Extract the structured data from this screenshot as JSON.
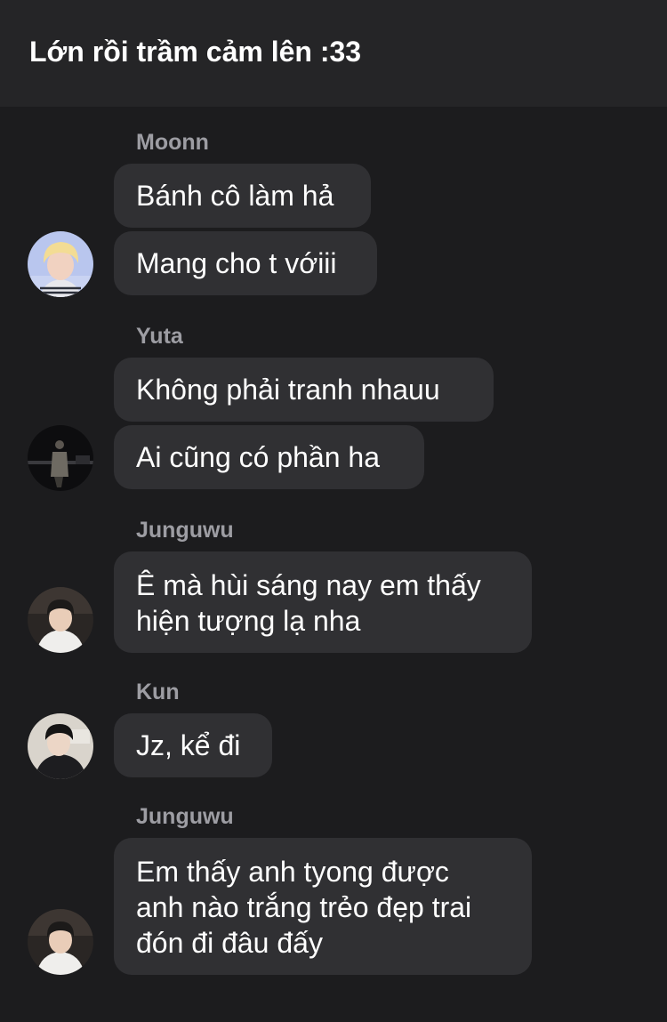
{
  "header": {
    "title": "Lớn rồi trầm cảm lên :33"
  },
  "groups": [
    {
      "sender": "Moonn",
      "avatar_icon": "blonde-person-avatar",
      "messages": [
        "Bánh cô làm hả",
        "Mang cho t vớiii"
      ]
    },
    {
      "sender": "Yuta",
      "avatar_icon": "dark-scene-person-avatar",
      "messages": [
        "Không phải tranh nhauu",
        "Ai cũng có phần ha"
      ]
    },
    {
      "sender": "Junguwu",
      "avatar_icon": "person-white-shirt-avatar",
      "messages": [
        [
          "Ê mà hùi sáng nay em thấy",
          "hiện tượng lạ nha"
        ]
      ]
    },
    {
      "sender": "Kun",
      "avatar_icon": "person-dark-jacket-avatar",
      "messages": [
        "Jz, kể đi"
      ]
    },
    {
      "sender": "Junguwu",
      "avatar_icon": "person-white-shirt-avatar",
      "messages": [
        [
          "Em thấy anh tyong được",
          "anh nào trắng trẻo đẹp trai",
          "đón đi đâu đấy"
        ]
      ]
    }
  ],
  "colors": {
    "background": "#1c1c1e",
    "header_background": "#252527",
    "bubble": "#303033",
    "sender_name": "#9d9da3",
    "text": "#ffffff"
  }
}
